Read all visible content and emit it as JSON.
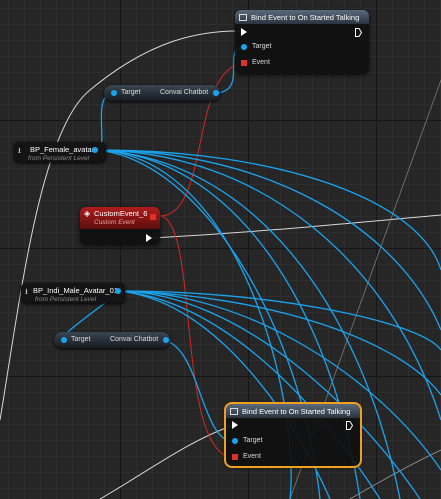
{
  "graph": {
    "bind_node_top": {
      "title": "Bind Event to On Started Talking",
      "pin_target": "Target",
      "pin_event": "Event"
    },
    "convai_chatbot_1": {
      "pin_target": "Target",
      "pin_output": "Convai Chatbot"
    },
    "bp_female_avatar": {
      "name": "BP_Female_avatar",
      "subtitle": "from Persistent Level"
    },
    "custom_event": {
      "title": "CustomEvent_6",
      "subtitle": "Custom Event"
    },
    "bp_indi_male_avatar": {
      "name": "BP_Indi_Male_Avatar_01",
      "subtitle": "from Persistent Level"
    },
    "convai_chatbot_2": {
      "pin_target": "Target",
      "pin_output": "Convai Chatbot"
    },
    "bind_node_bottom": {
      "title": "Bind Event to On Started Talking",
      "pin_target": "Target",
      "pin_event": "Event"
    },
    "colors": {
      "object_wire": "#1aa4ef",
      "delegate_wire": "#e0302a",
      "exec_wire": "#e8e8e8",
      "selection": "#f0a020"
    }
  }
}
